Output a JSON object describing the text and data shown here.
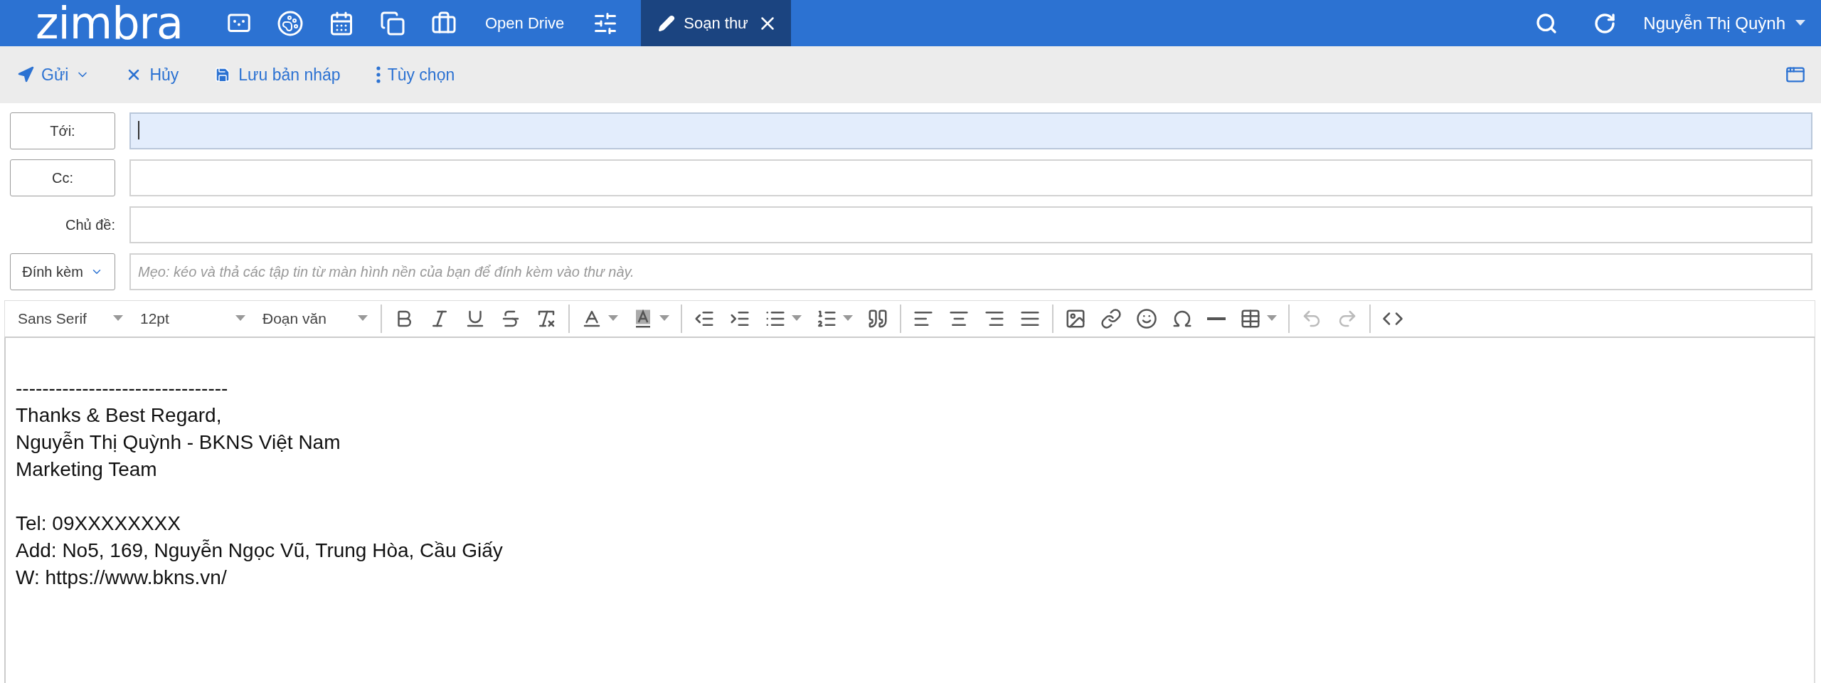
{
  "top_bar": {
    "logo": "zimbra",
    "links": [
      {
        "label": "Open Drive",
        "selected": false
      }
    ],
    "compose_tab": {
      "label": "Soạn thư",
      "selected": true
    },
    "user": "Nguyễn Thị Quỳnh"
  },
  "actions": [
    {
      "label": "Gửi",
      "has_menu": true
    },
    {
      "label": "Hủy",
      "has_menu": false
    },
    {
      "label": "Lưu bản nháp",
      "has_menu": false
    },
    {
      "label": "Tùy chọn",
      "has_menu": false
    }
  ],
  "fields": [
    {
      "label": "Tới:",
      "kind": "button",
      "focused": true
    },
    {
      "label": "Cc:",
      "kind": "button",
      "focused": false
    },
    {
      "label": "Chủ đề:",
      "kind": "plain",
      "focused": false
    },
    {
      "label": "Đính kèm",
      "kind": "menu",
      "focused": false,
      "placeholder": "Mẹo: kéo và thả các tập tin từ màn hình nền của bạn để đính kèm vào thư này."
    }
  ],
  "editor_toolbar": {
    "dropdowns": [
      "Sans Serif",
      "12pt",
      "Đoạn văn"
    ],
    "groups": [
      [
        {
          "has_menu": false,
          "disabled": false
        },
        {
          "has_menu": false,
          "disabled": false
        },
        {
          "has_menu": false,
          "disabled": false
        },
        {
          "has_menu": false,
          "disabled": false
        },
        {
          "has_menu": false,
          "disabled": false
        }
      ],
      [
        {
          "has_menu": true,
          "disabled": false
        },
        {
          "has_menu": true,
          "disabled": false
        }
      ],
      [
        {
          "has_menu": false,
          "disabled": false
        },
        {
          "has_menu": false,
          "disabled": false
        },
        {
          "has_menu": true,
          "disabled": false
        },
        {
          "has_menu": true,
          "disabled": false
        },
        {
          "has_menu": false,
          "disabled": false
        }
      ],
      [
        {
          "has_menu": false,
          "disabled": false
        },
        {
          "has_menu": false,
          "disabled": false
        },
        {
          "has_menu": false,
          "disabled": false
        },
        {
          "has_menu": false,
          "disabled": false
        }
      ],
      [
        {
          "has_menu": false,
          "disabled": false
        },
        {
          "has_menu": false,
          "disabled": false
        },
        {
          "has_menu": false,
          "disabled": false
        },
        {
          "has_menu": false,
          "disabled": false
        },
        {
          "has_menu": false,
          "disabled": false
        },
        {
          "has_menu": true,
          "disabled": false
        }
      ],
      [
        {
          "has_menu": false,
          "disabled": true
        },
        {
          "has_menu": false,
          "disabled": true
        }
      ],
      [
        {
          "has_menu": false,
          "disabled": false
        }
      ]
    ]
  },
  "body": [
    [
      "--------------------------------",
      "Thanks & Best Regard,",
      "Nguyễn Thị Quỳnh - BKNS Việt Nam",
      "Marketing Team"
    ],
    [
      "Tel: 09XXXXXXXX",
      "Add: No5, 169, Nguyễn Ngọc Vũ, Trung Hòa, Cầu Giấy",
      "W: https://www.bkns.vn/"
    ]
  ]
}
